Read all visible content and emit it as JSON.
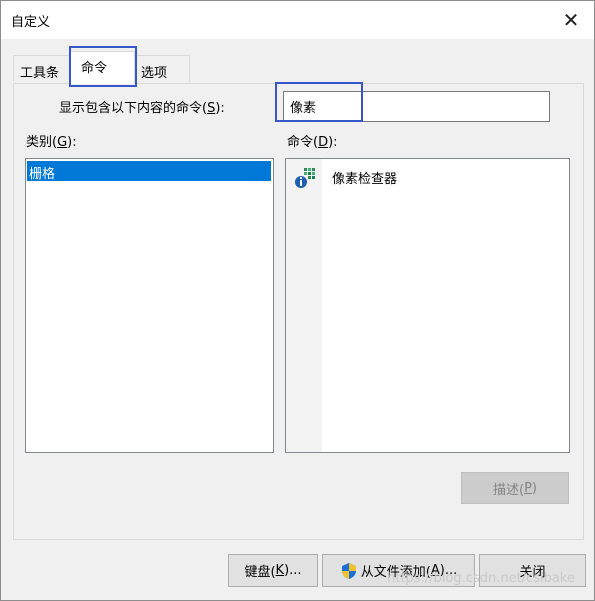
{
  "window": {
    "title": "自定义",
    "close_glyph": "✕"
  },
  "tabs": [
    {
      "label": "工具条"
    },
    {
      "label": "命令"
    },
    {
      "label": "选项"
    }
  ],
  "filter": {
    "label_prefix": "显示包含以下内容的命令(",
    "label_key": "S",
    "label_suffix": "):",
    "value": "像素"
  },
  "categories": {
    "label_prefix": "类别(",
    "label_key": "G",
    "label_suffix": "):",
    "items": [
      "栅格"
    ],
    "selected": "栅格"
  },
  "commands": {
    "label_prefix": "命令(",
    "label_key": "D",
    "label_suffix": "):",
    "items": [
      {
        "icon": "pixel-inspector-icon",
        "label": "像素检查器"
      }
    ]
  },
  "buttons": {
    "describe": {
      "prefix": "描述(",
      "key": "P",
      "suffix": ")"
    },
    "keyboard": {
      "prefix": "键盘(",
      "key": "K",
      "suffix": ")..."
    },
    "add_from_file": {
      "prefix": "从文件添加(",
      "key": "A",
      "suffix": ")..."
    },
    "close": "关闭"
  },
  "watermark": "https://blog.csdn.net/csibake",
  "colors": {
    "selection": "#0078d7",
    "highlight": "#3557c9"
  }
}
